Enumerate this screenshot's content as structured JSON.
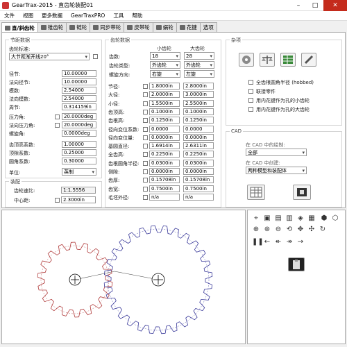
{
  "window": {
    "title": "GearTrax-2015 - 直齿轮装配01"
  },
  "menu": [
    "文件",
    "视图",
    "更多数据",
    "GearTraxPRO",
    "工具",
    "帮助"
  ],
  "tabs": [
    "直/斜齿轮",
    "锥齿轮",
    "链轮",
    "同步带轮",
    "皮带轮",
    "蜗轮",
    "花键",
    "选项"
  ],
  "left": {
    "section": "节距数据",
    "standard_label": "齿轮标准:",
    "standard_value": "大节距渐开线20°",
    "fields": [
      {
        "label": "径节:",
        "value": "10.00000"
      },
      {
        "label": "法向径节:",
        "value": "10.00000"
      },
      {
        "label": "模数:",
        "value": "2.54000"
      },
      {
        "label": "法向模数:",
        "value": "2.54000"
      },
      {
        "label": "周节:",
        "value": "0.314159in"
      },
      {
        "label": "压力角:",
        "value": "20.0000deg"
      },
      {
        "label": "法向压力角:",
        "value": "20.0000deg"
      },
      {
        "label": "螺旋角:",
        "value": "0.0000deg"
      },
      {
        "label": "齿顶高系数:",
        "value": "1.00000"
      },
      {
        "label": "顶隙系数:",
        "value": "0.25000"
      },
      {
        "label": "圆角系数:",
        "value": "0.30000"
      }
    ],
    "unit_label": "单位:",
    "unit_value": "英制",
    "assembly_section": "装配",
    "ratio_label": "齿轮速比:",
    "ratio_value": "1:1.5556",
    "center_label": "中心距:",
    "center_value": "2.3000in"
  },
  "middle": {
    "section": "齿轮数据",
    "col_small": "小齿轮",
    "col_large": "大齿轮",
    "teeth_label": "齿数:",
    "teeth_small": "18",
    "teeth_large": "28",
    "type_label": "齿轮类型:",
    "type_small": "外齿轮",
    "type_large": "外齿轮",
    "helix_label": "螺旋方向:",
    "helix_small": "右旋",
    "helix_large": "左旋",
    "rows": [
      {
        "label": "节径:",
        "small": "1.8000in",
        "large": "2.8000in"
      },
      {
        "label": "大径:",
        "small": "2.0000in",
        "large": "3.0000in"
      },
      {
        "label": "小径:",
        "small": "1.5500in",
        "large": "2.5500in"
      },
      {
        "label": "齿顶高:",
        "small": "0.1000in",
        "large": "0.1000in"
      },
      {
        "label": "齿根高:",
        "small": "0.1250in",
        "large": "0.1250in"
      },
      {
        "label": "径向变位系数:",
        "small": "0.0000",
        "large": "0.0000"
      },
      {
        "label": "径向变位量:",
        "small": "0.0000in",
        "large": "0.0000in"
      },
      {
        "label": "基圆直径:",
        "small": "1.6914in",
        "large": "2.6311in"
      },
      {
        "label": "全齿高:",
        "small": "0.2250in",
        "large": "0.2250in"
      },
      {
        "label": "齿根圆角半径:",
        "small": "0.0300in",
        "large": "0.0300in"
      },
      {
        "label": "侧隙:",
        "small": "0.0000in",
        "large": "0.0000in"
      },
      {
        "label": "齿厚:",
        "small": "0.15708in",
        "large": "0.15708in"
      },
      {
        "label": "齿宽:",
        "small": "0.7500in",
        "large": "0.7500in"
      },
      {
        "label": "毛坯外径:",
        "small": "n/a",
        "large": "n/a"
      }
    ]
  },
  "misc": {
    "section": "杂项",
    "checks": [
      "全齿根圆角半径 (hobbed)",
      "联接零件",
      "用内花键作为孔的小齿轮",
      "用内花键作为孔的大齿轮"
    ]
  },
  "cad": {
    "section": "CAD",
    "draw_label": "在 CAD 中的绘制:",
    "draw_value": "全部",
    "create_label": "在 CAD 中创建:",
    "create_value": "两种模型和装配体"
  }
}
